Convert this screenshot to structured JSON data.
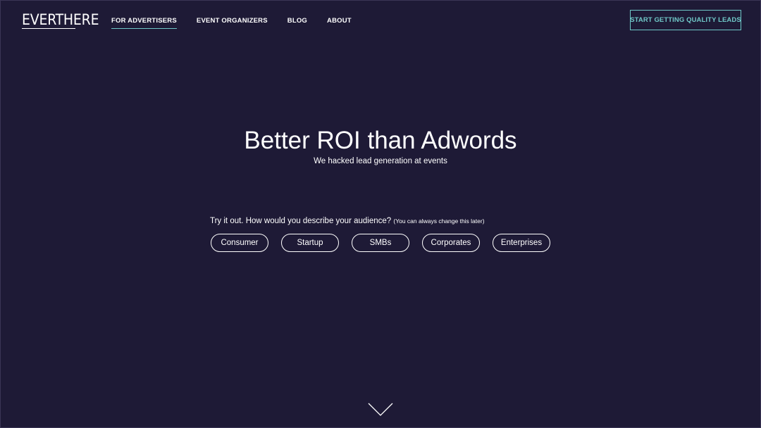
{
  "brand": {
    "logo_text": "EVERTHERE"
  },
  "nav": {
    "items": [
      {
        "label": "FOR ADVERTISERS",
        "active": true
      },
      {
        "label": "EVENT ORGANIZERS",
        "active": false
      },
      {
        "label": "BLOG",
        "active": false
      },
      {
        "label": "ABOUT",
        "active": false
      }
    ],
    "cta_label": "START GETTING QUALITY LEADS"
  },
  "hero": {
    "title": "Better ROI than Adwords",
    "subtitle": "We hacked lead generation at events"
  },
  "audience": {
    "prompt": "Try it out. How would you describe your audience?",
    "note": "(You can always change this later)",
    "options": [
      "Consumer",
      "Startup",
      "SMBs",
      "Corporates",
      "Enterprises"
    ]
  },
  "icons": {
    "scroll": "chevron-down-icon"
  },
  "colors": {
    "background": "#1e1a36",
    "accent": "#6fc7c7",
    "text": "#ffffff"
  }
}
